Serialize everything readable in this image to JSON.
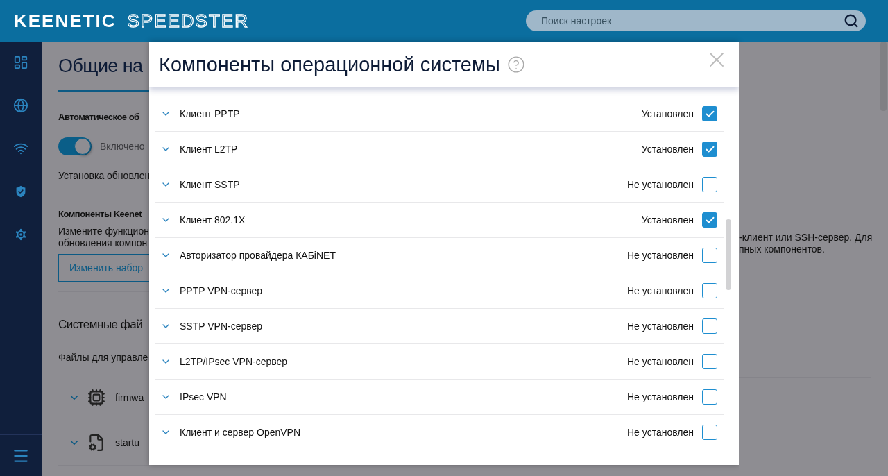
{
  "header": {
    "logo": {
      "brand": "KEENETIC",
      "model": "SPEEDSTER"
    },
    "search": {
      "placeholder": "Поиск настроек"
    }
  },
  "sidebar": {
    "items": [
      {
        "kind": "dashboard"
      },
      {
        "kind": "globe"
      },
      {
        "kind": "wifi"
      },
      {
        "kind": "shield"
      },
      {
        "kind": "settings"
      }
    ],
    "menu": {
      "kind": "menu"
    }
  },
  "page": {
    "title": "Общие на",
    "auto_update": {
      "heading": "Автоматическое об",
      "on": true,
      "state_label": "Включено",
      "note": "Установка обновлен"
    },
    "components": {
      "heading": "Компоненты Keenet",
      "description_left": [
        "Измените функцион",
        "обновления компон"
      ],
      "description_right": [
        "-клиент или SSH-сервер. Для",
        "пных компонентов."
      ],
      "button": "Изменить набор"
    },
    "system_files": {
      "heading": "Системные фай",
      "note": "Файлы для управле",
      "files": [
        {
          "kind": "chip",
          "name": "firmwa"
        },
        {
          "kind": "gear",
          "name": "startu"
        }
      ]
    }
  },
  "dialog": {
    "title": "Компоненты операционной системы",
    "components": [
      {
        "name": "Клиент PPTP",
        "status": "Установлен",
        "checked": true
      },
      {
        "name": "Клиент L2TP",
        "status": "Установлен",
        "checked": true
      },
      {
        "name": "Клиент SSTP",
        "status": "Не установлен",
        "checked": false
      },
      {
        "name": "Клиент 802.1X",
        "status": "Установлен",
        "checked": true
      },
      {
        "name": "Авторизатор провайдера КАБiNET",
        "status": "Не установлен",
        "checked": false
      },
      {
        "name": "PPTP VPN-сервер",
        "status": "Не установлен",
        "checked": false
      },
      {
        "name": "SSTP VPN-сервер",
        "status": "Не установлен",
        "checked": false
      },
      {
        "name": "L2TP/IPsec VPN-сервер",
        "status": "Не установлен",
        "checked": false
      },
      {
        "name": "IPsec VPN",
        "status": "Не установлен",
        "checked": false
      },
      {
        "name": "Клиент и сервер OpenVPN",
        "status": "Не установлен",
        "checked": false
      }
    ]
  }
}
